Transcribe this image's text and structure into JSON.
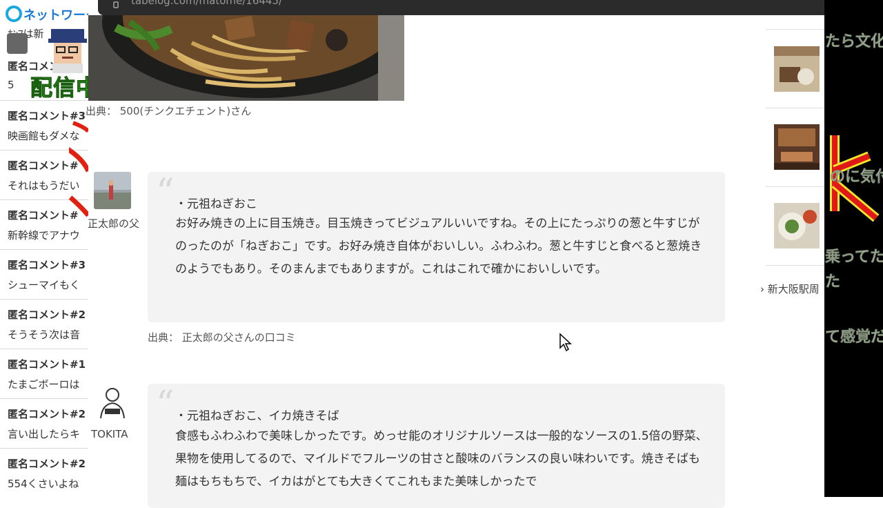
{
  "stream": {
    "logo_text": "ネットワーク",
    "first_line": "ﾎﾝﾏは新",
    "live_badge": "配信中"
  },
  "comments": [
    {
      "name": "匿名コメント#",
      "text": "5"
    },
    {
      "name": "匿名コメント#3",
      "text": "映画館もダメな"
    },
    {
      "name": "匿名コメント#",
      "text": "それはもうだい"
    },
    {
      "name": "匿名コメント#",
      "text": "新幹線でアナウ"
    },
    {
      "name": "匿名コメント#3",
      "text": "シューマイもく"
    },
    {
      "name": "匿名コメント#2",
      "text": "そうそう次は音"
    },
    {
      "name": "匿名コメント#1",
      "text": "たまごボーロは"
    },
    {
      "name": "匿名コメント#2",
      "text": "言い出したらキ"
    },
    {
      "name": "匿名コメント#2",
      "text": "554くさいよね"
    }
  ],
  "browser": {
    "url": "tabelog.com/matome/16445/"
  },
  "page": {
    "image_caption": "出典： 500(チンクエチェント)さん",
    "reviews": [
      {
        "user": "正太郎の父",
        "title": "・元祖ねぎおこ",
        "body": "お好み焼きの上に目玉焼き。目玉焼きってビジュアルいいですね。その上にたっぷりの葱と牛すじがのったのが「ねぎおこ」です。お好み焼き自体がおいしい。ふわふわ。葱と牛すじと食べると葱焼きのようでもあり。そのまんまでもありますが。これはこれで確かにおいしいです。",
        "source": "出典： 正太郎の父さんの口コミ"
      },
      {
        "user": "TOKITA",
        "title": "・元祖ねぎおこ、イカ焼きそば",
        "body": "食感もふわふわで美味しかったです。めっせ能のオリジナルソースは一般的なソースの1.5倍の野菜、果物を使用してるので、マイルドでフルーツの甘さと酸味のバランスの良い味わいです。焼きそばも麺はもちもちで、イカはがとても大きくてこれもまた美味しかったで"
      }
    ],
    "sidebar_link": "新大阪駅周"
  },
  "overlay": {
    "lines": [
      "たら文化",
      "のに気付",
      "乗ってた",
      "た",
      "て感覚だ"
    ]
  },
  "colors": {
    "accent_green": "#55e830",
    "overlay_text": "#c8d6bf",
    "logo_blue": "#1a78d6"
  }
}
